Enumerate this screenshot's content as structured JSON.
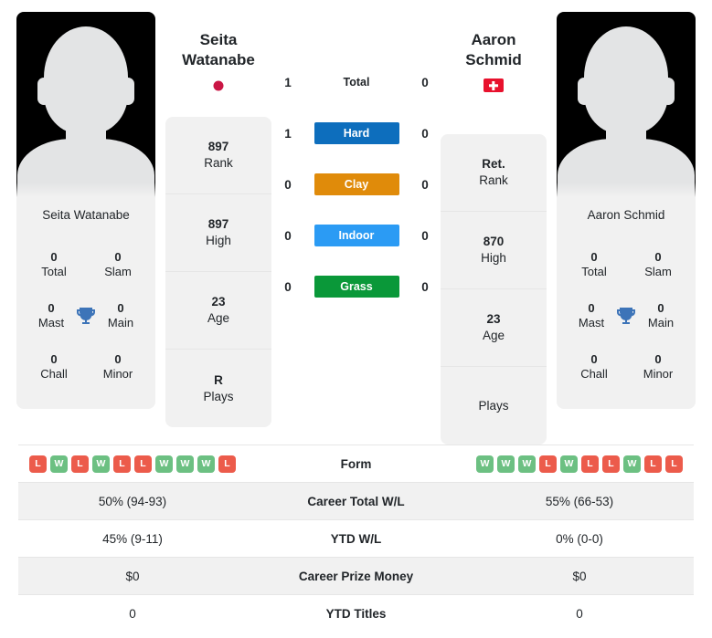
{
  "players": {
    "left": {
      "first_name": "Seita",
      "last_name": "Watanabe",
      "full_name": "Seita Watanabe",
      "flag": "japan-flag",
      "stats": [
        {
          "value": "897",
          "label": "Rank"
        },
        {
          "value": "897",
          "label": "High"
        },
        {
          "value": "23",
          "label": "Age"
        },
        {
          "value": "R",
          "label": "Plays"
        }
      ],
      "titles": [
        {
          "value": "0",
          "label": "Total"
        },
        {
          "value": "0",
          "label": "Slam"
        },
        {
          "value": "0",
          "label": "Mast"
        },
        {
          "value": "0",
          "label": "Main"
        },
        {
          "value": "0",
          "label": "Chall"
        },
        {
          "value": "0",
          "label": "Minor"
        }
      ],
      "form": [
        "L",
        "W",
        "L",
        "W",
        "L",
        "L",
        "W",
        "W",
        "W",
        "L"
      ],
      "career_total_wl": "50% (94-93)",
      "ytd_wl": "45% (9-11)",
      "career_prize_money": "$0",
      "ytd_titles": "0"
    },
    "right": {
      "first_name": "Aaron",
      "last_name": "Schmid",
      "full_name": "Aaron Schmid",
      "flag": "switzerland-flag",
      "stats": [
        {
          "value": "Ret.",
          "label": "Rank"
        },
        {
          "value": "870",
          "label": "High"
        },
        {
          "value": "23",
          "label": "Age"
        },
        {
          "value": "",
          "label": "Plays"
        }
      ],
      "titles": [
        {
          "value": "0",
          "label": "Total"
        },
        {
          "value": "0",
          "label": "Slam"
        },
        {
          "value": "0",
          "label": "Mast"
        },
        {
          "value": "0",
          "label": "Main"
        },
        {
          "value": "0",
          "label": "Chall"
        },
        {
          "value": "0",
          "label": "Minor"
        }
      ],
      "form": [
        "W",
        "W",
        "W",
        "L",
        "W",
        "L",
        "L",
        "W",
        "L",
        "L"
      ],
      "career_total_wl": "55% (66-53)",
      "ytd_wl": "0% (0-0)",
      "career_prize_money": "$0",
      "ytd_titles": "0"
    }
  },
  "head_to_head": [
    {
      "label": "Total",
      "left": "1",
      "right": "0",
      "style": "plain",
      "color": ""
    },
    {
      "label": "Hard",
      "left": "1",
      "right": "0",
      "style": "pill",
      "color": "#0d6ebd"
    },
    {
      "label": "Clay",
      "left": "0",
      "right": "0",
      "style": "pill",
      "color": "#e08b0a"
    },
    {
      "label": "Indoor",
      "left": "0",
      "right": "0",
      "style": "pill",
      "color": "#2b9bf4"
    },
    {
      "label": "Grass",
      "left": "0",
      "right": "0",
      "style": "pill",
      "color": "#0a9839"
    }
  ],
  "comparison_table": {
    "rows": [
      {
        "label": "Form",
        "type": "form",
        "left": "",
        "right": "",
        "shaded": false
      },
      {
        "label": "Career Total W/L",
        "type": "text",
        "left": "50% (94-93)",
        "right": "55% (66-53)",
        "shaded": true
      },
      {
        "label": "YTD W/L",
        "type": "text",
        "left": "45% (9-11)",
        "right": "0% (0-0)",
        "shaded": false
      },
      {
        "label": "Career Prize Money",
        "type": "text",
        "left": "$0",
        "right": "$0",
        "shaded": true
      },
      {
        "label": "YTD Titles",
        "type": "text",
        "left": "0",
        "right": "0",
        "shaded": false
      }
    ]
  },
  "colors": {
    "hard": "#0d6ebd",
    "clay": "#e08b0a",
    "indoor": "#2b9bf4",
    "grass": "#0a9839",
    "win_badge": "#6cc082",
    "loss_badge": "#ec5b4b",
    "trophy": "#3d74b8",
    "card_bg": "#f1f1f1"
  }
}
